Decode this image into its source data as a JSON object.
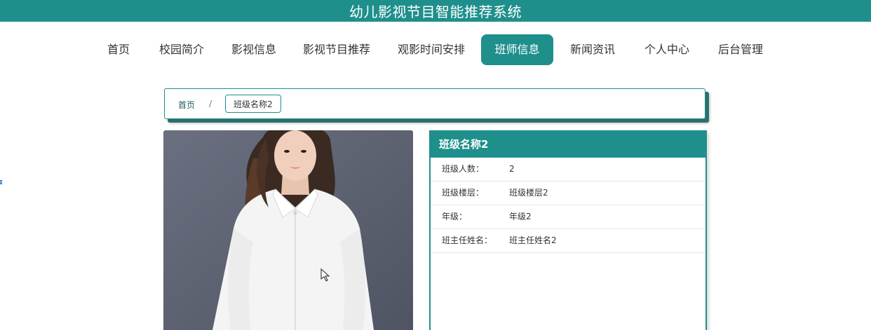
{
  "header": {
    "title": "幼儿影视节目智能推荐系统"
  },
  "nav": {
    "items": [
      {
        "label": "首页"
      },
      {
        "label": "校园简介"
      },
      {
        "label": "影视信息"
      },
      {
        "label": "影视节目推荐"
      },
      {
        "label": "观影时间安排"
      },
      {
        "label": "班师信息",
        "active": true
      },
      {
        "label": "新闻资讯"
      },
      {
        "label": "个人中心"
      },
      {
        "label": "后台管理"
      }
    ]
  },
  "breadcrumb": {
    "home": "首页",
    "separator": "/",
    "current": "班级名称2"
  },
  "detail": {
    "title": "班级名称2",
    "rows": [
      {
        "label": "班级人数：",
        "value": "2"
      },
      {
        "label": "班级楼层：",
        "value": "班级楼层2"
      },
      {
        "label": "年级：",
        "value": "年级2"
      },
      {
        "label": "班主任姓名：",
        "value": "班主任姓名2"
      }
    ]
  },
  "colors": {
    "primary": "#1f8f8c",
    "shadow": "#2c6f6d"
  }
}
